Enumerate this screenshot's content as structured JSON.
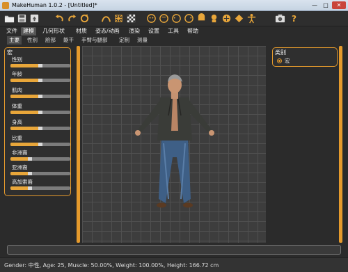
{
  "window": {
    "title": "MakeHuman 1.0.2 - [Untitled]*",
    "minimize": "—",
    "maximize": "□",
    "close": "✕"
  },
  "toolbar": {
    "buttons": [
      {
        "icon": "folder-icon"
      },
      {
        "icon": "save-icon"
      },
      {
        "icon": "export-icon"
      },
      {
        "icon": "undo-icon"
      },
      {
        "icon": "redo-icon"
      },
      {
        "icon": "reset-icon"
      },
      {
        "icon": "smooth-icon"
      },
      {
        "icon": "wireframe-icon"
      },
      {
        "icon": "background-icon"
      },
      {
        "icon": "front-view-icon"
      },
      {
        "icon": "back-view-icon"
      },
      {
        "icon": "left-view-icon"
      },
      {
        "icon": "right-view-icon"
      },
      {
        "icon": "top-view-icon"
      },
      {
        "icon": "bottom-view-icon"
      },
      {
        "icon": "reset-camera-icon"
      },
      {
        "icon": "pose-icon"
      },
      {
        "icon": "screenshot-icon"
      },
      {
        "icon": "help-icon"
      }
    ]
  },
  "menu": [
    "文件",
    "建模",
    "几何形状",
    "材质",
    "姿态/动画",
    "渲染",
    "设置",
    "工具",
    "帮助"
  ],
  "menu_active": "建模",
  "subtabs": [
    "主要",
    "性别",
    "脸部",
    "躯干",
    "手臂与腿部",
    "定制",
    "测量"
  ],
  "subtab_active": "主要",
  "left_panel": {
    "title": "宏",
    "sliders": [
      {
        "label": "性别",
        "value": 0.5
      },
      {
        "label": "年龄",
        "value": 0.5
      },
      {
        "label": "肌肉",
        "value": 0.5
      },
      {
        "label": "体重",
        "value": 0.5
      },
      {
        "label": "身高",
        "value": 0.5
      },
      {
        "label": "比重",
        "value": 0.5
      },
      {
        "label": "非洲裔",
        "value": 0.33
      },
      {
        "label": "亚洲裔",
        "value": 0.33
      },
      {
        "label": "高加索裔",
        "value": 0.33
      }
    ]
  },
  "right_panel": {
    "title": "类别",
    "option": "宏"
  },
  "status": "Gender: 中性, Age: 25, Muscle: 50.00%, Weight: 100.00%, Height: 166.72 cm",
  "colors": {
    "accent": "#e59a2c",
    "background": "#2b2b2b",
    "grid": "#3d3d3d"
  }
}
